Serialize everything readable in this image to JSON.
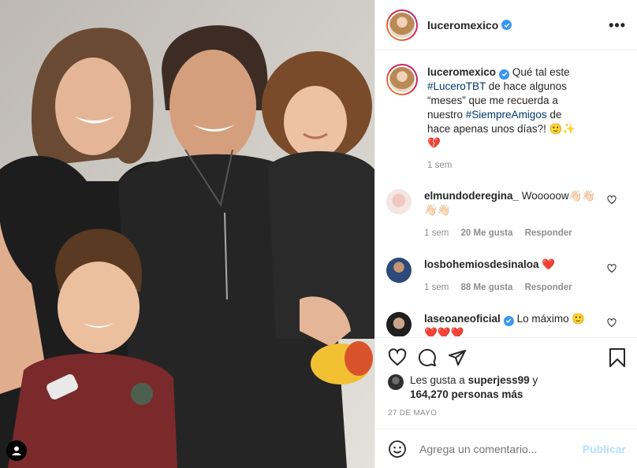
{
  "post": {
    "username": "luceromexico",
    "caption_lines": {
      "a": "Qué tal este",
      "tag1": "#LuceroTBT",
      "b": " de hace algunos “meses” que me recuerda a nuestro ",
      "tag2": "#SiempreAmigos",
      "c": " de hace apenas unos días?! 🙂✨💔"
    },
    "caption_time": "1 sem"
  },
  "comments": [
    {
      "user": "elmundoderegina_",
      "text": "Wooooow👋🏻👋🏻👋🏻👋🏻",
      "time": "1 sem",
      "likes": "20 Me gusta",
      "reply": "Responder"
    },
    {
      "user": "losbohemiosdesinaloa",
      "text": "❤️",
      "time": "1 sem",
      "likes": "88 Me gusta",
      "reply": "Responder"
    },
    {
      "user": "laseoaneoficial",
      "text": "Lo máximo 🙂 ❤️❤️❤️",
      "time": "",
      "likes": "",
      "reply": ""
    }
  ],
  "likes_line": {
    "prefix": "Les gusta a ",
    "user": "superjess99",
    "mid": " y ",
    "count": "164,270 personas más"
  },
  "date": "27 DE MAYO",
  "add_comment": {
    "placeholder": "Agrega un comentario...",
    "publish": "Publicar"
  },
  "colors": {
    "verified": "#3897f0",
    "hashtag": "#00376b",
    "publish_disabled": "#b2dffc",
    "muted": "#8e8e8e"
  },
  "icons": [
    "more-options-icon",
    "heart-icon",
    "comment-icon",
    "share-icon",
    "bookmark-icon",
    "emoji-icon",
    "user-tag-icon",
    "verified-badge-icon"
  ]
}
